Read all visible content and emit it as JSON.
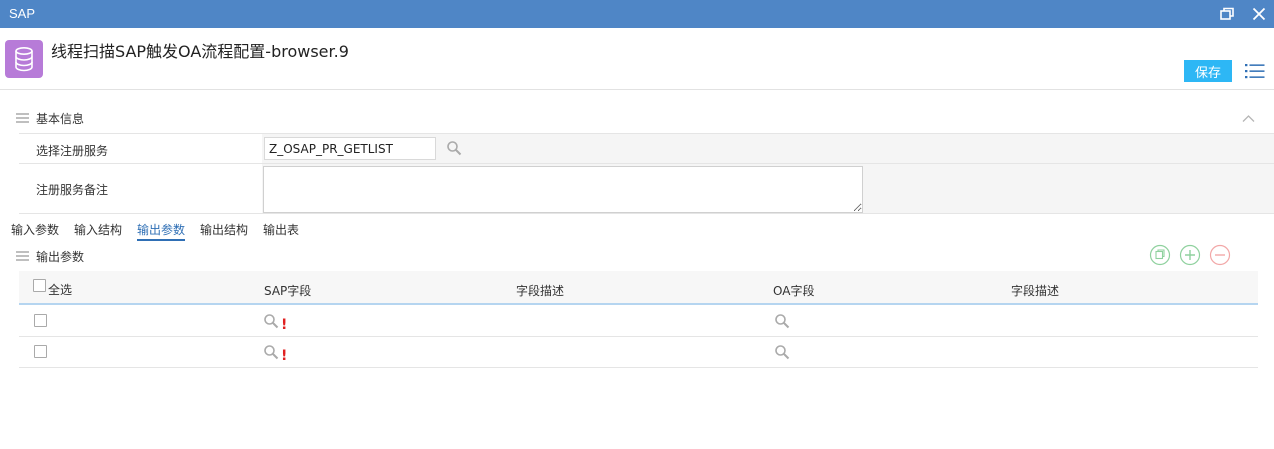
{
  "window": {
    "title": "SAP"
  },
  "header": {
    "page_title": "线程扫描SAP触发OA流程配置-browser.9",
    "save_label": "保存"
  },
  "basic_section": {
    "title": "基本信息",
    "fields": [
      {
        "label": "选择注册服务",
        "value": "Z_OSAP_PR_GETLIST"
      },
      {
        "label": "注册服务备注",
        "value": ""
      }
    ]
  },
  "tabs": [
    {
      "label": "输入参数",
      "active": false
    },
    {
      "label": "输入结构",
      "active": false
    },
    {
      "label": "输出参数",
      "active": true
    },
    {
      "label": "输出结构",
      "active": false
    },
    {
      "label": "输出表",
      "active": false
    }
  ],
  "output_section": {
    "title": "输出参数",
    "columns": {
      "select_all": "全选",
      "sap_field": "SAP字段",
      "field_desc_1": "字段描述",
      "oa_field": "OA字段",
      "field_desc_2": "字段描述"
    },
    "rows": [
      {
        "sap_field": "",
        "field_desc_1": "",
        "oa_field": "",
        "field_desc_2": "",
        "required_mark": "!"
      },
      {
        "sap_field": "",
        "field_desc_1": "",
        "oa_field": "",
        "field_desc_2": "",
        "required_mark": "!"
      }
    ]
  },
  "colors": {
    "titlebar": "#4f86c6",
    "save_button": "#2db7f5",
    "app_icon": "#b77bd8",
    "active_tab": "#2f6fb5",
    "required": "#e02020",
    "tool_green": "#8fd19e",
    "tool_red": "#f2a7a7"
  },
  "icons": [
    "restore-icon",
    "close-icon",
    "database-icon",
    "menu-list-icon",
    "hamburger-icon",
    "chevron-up-icon",
    "search-icon",
    "copy-icon",
    "add-icon",
    "remove-icon"
  ]
}
